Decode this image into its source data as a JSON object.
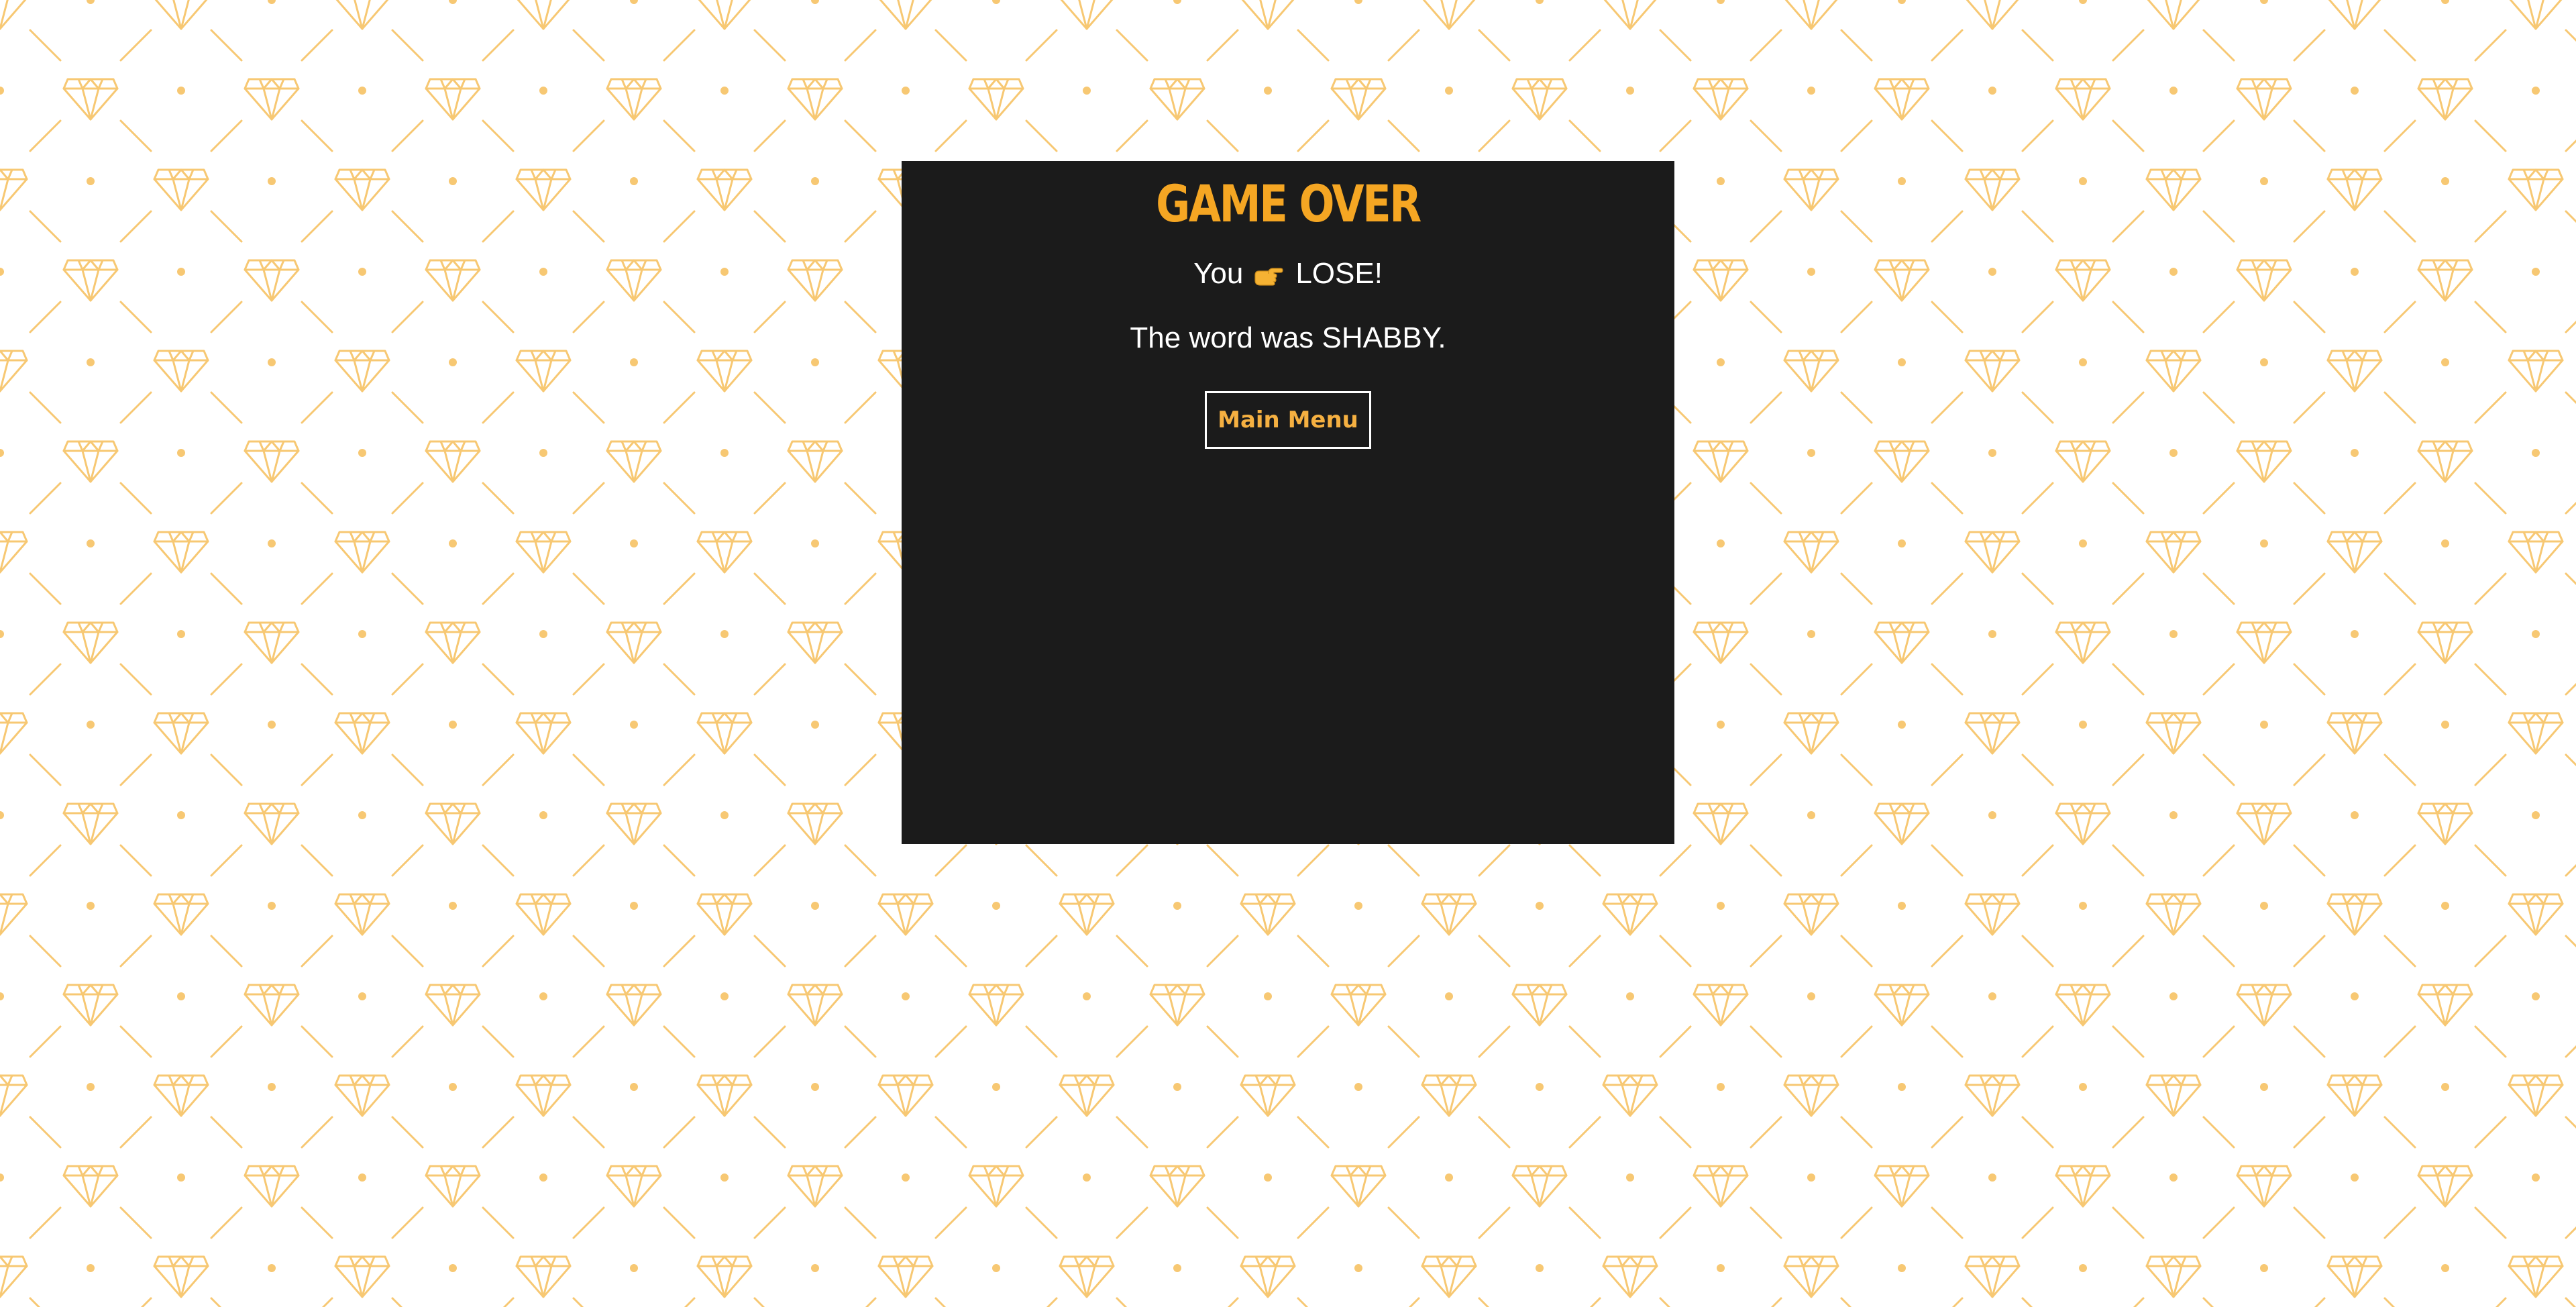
{
  "colors": {
    "page_background": "#ffffff",
    "pattern": "#f7c873",
    "panel_background": "#1b1b1b",
    "accent": "#f5a623",
    "text": "#ffffff"
  },
  "background": {
    "pattern_icon": "diamond-icon"
  },
  "game_over": {
    "title": "GAME OVER",
    "result_prefix": "You",
    "result_icon": "pointing-hand-icon",
    "result_suffix": "LOSE!",
    "word_message": "The word was SHABBY.",
    "main_menu_label": "Main Menu"
  }
}
